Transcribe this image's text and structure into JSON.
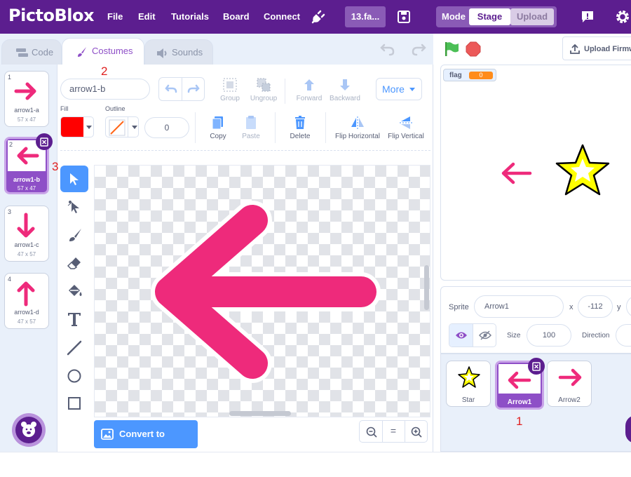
{
  "topbar": {
    "logo": "PictoBlox",
    "menu": [
      "File",
      "Edit",
      "Tutorials",
      "Board",
      "Connect"
    ],
    "project_name": "13.fa...",
    "mode_label": "Mode",
    "stage_label": "Stage",
    "upload_label": "Upload"
  },
  "tabs": {
    "code": "Code",
    "costumes": "Costumes",
    "sounds": "Sounds"
  },
  "upload_firmware": "Upload Firmw",
  "costumes": [
    {
      "num": "1",
      "name": "arrow1-a",
      "size": "57 x 47",
      "dir": "right"
    },
    {
      "num": "2",
      "name": "arrow1-b",
      "size": "57 x 47",
      "dir": "left"
    },
    {
      "num": "3",
      "name": "arrow1-c",
      "size": "47 x 57",
      "dir": "down"
    },
    {
      "num": "4",
      "name": "arrow1-d",
      "size": "47 x 57",
      "dir": "up"
    }
  ],
  "editor": {
    "costume_name": "arrow1-b",
    "group": "Group",
    "ungroup": "Ungroup",
    "forward": "Forward",
    "backward": "Backward",
    "more": "More",
    "fill_label": "Fill",
    "outline_label": "Outline",
    "outline_width": "0",
    "copy": "Copy",
    "paste": "Paste",
    "delete": "Delete",
    "flip_h": "Flip Horizontal",
    "flip_v": "Flip Vertical",
    "convert": "Convert to Bitmap",
    "zoom_reset": "="
  },
  "stage": {
    "monitor_label": "flag",
    "monitor_value": "0"
  },
  "sprite_info": {
    "sprite_label": "Sprite",
    "sprite_name": "Arrow1",
    "x_label": "x",
    "x_value": "-112",
    "y_label": "y",
    "size_label": "Size",
    "size_value": "100",
    "direction_label": "Direction"
  },
  "sprites": [
    {
      "name": "Star"
    },
    {
      "name": "Arrow1"
    },
    {
      "name": "Arrow2"
    }
  ],
  "annotations": {
    "a1": "1",
    "a2": "2",
    "a3": "3"
  },
  "colors": {
    "brand": "#5c1e8f",
    "accent": "#8e4fc7",
    "blue": "#4c97ff",
    "arrow": "#ee2a7b",
    "fill": "#ff0000"
  }
}
